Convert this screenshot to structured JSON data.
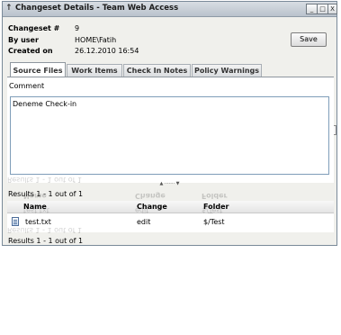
{
  "window": {
    "title": "Changeset Details - Team Web Access",
    "minimize": "_",
    "maximize": "□",
    "close": "X"
  },
  "changeset": {
    "number_label": "Changeset #",
    "number_value": "9",
    "user_label": "By user",
    "user_value": "HOME\\Fatih",
    "created_label": "Created on",
    "created_value": "26.12.2010 16:54"
  },
  "toolbar": {
    "save_label": "Save"
  },
  "tabs": [
    {
      "label": "Source Files",
      "active": true
    },
    {
      "label": "Work Items",
      "active": false
    },
    {
      "label": "Check In Notes",
      "active": false
    },
    {
      "label": "Policy Warnings",
      "active": false
    }
  ],
  "tab_scroll": {
    "left": "<",
    "right": ">"
  },
  "comment": {
    "label": "Comment",
    "value": "Deneme Check-in"
  },
  "splitter": "▲ ······· ▼",
  "results": {
    "summary_top": "Results 1 - 1 out of 1",
    "summary_bottom": "Results 1 - 1 out of 1",
    "columns": [
      "Name",
      "Change",
      "Folder"
    ],
    "rows": [
      {
        "name": "test.txt",
        "change": "edit",
        "folder": "$/Test",
        "icon": "text-file-icon"
      }
    ]
  }
}
